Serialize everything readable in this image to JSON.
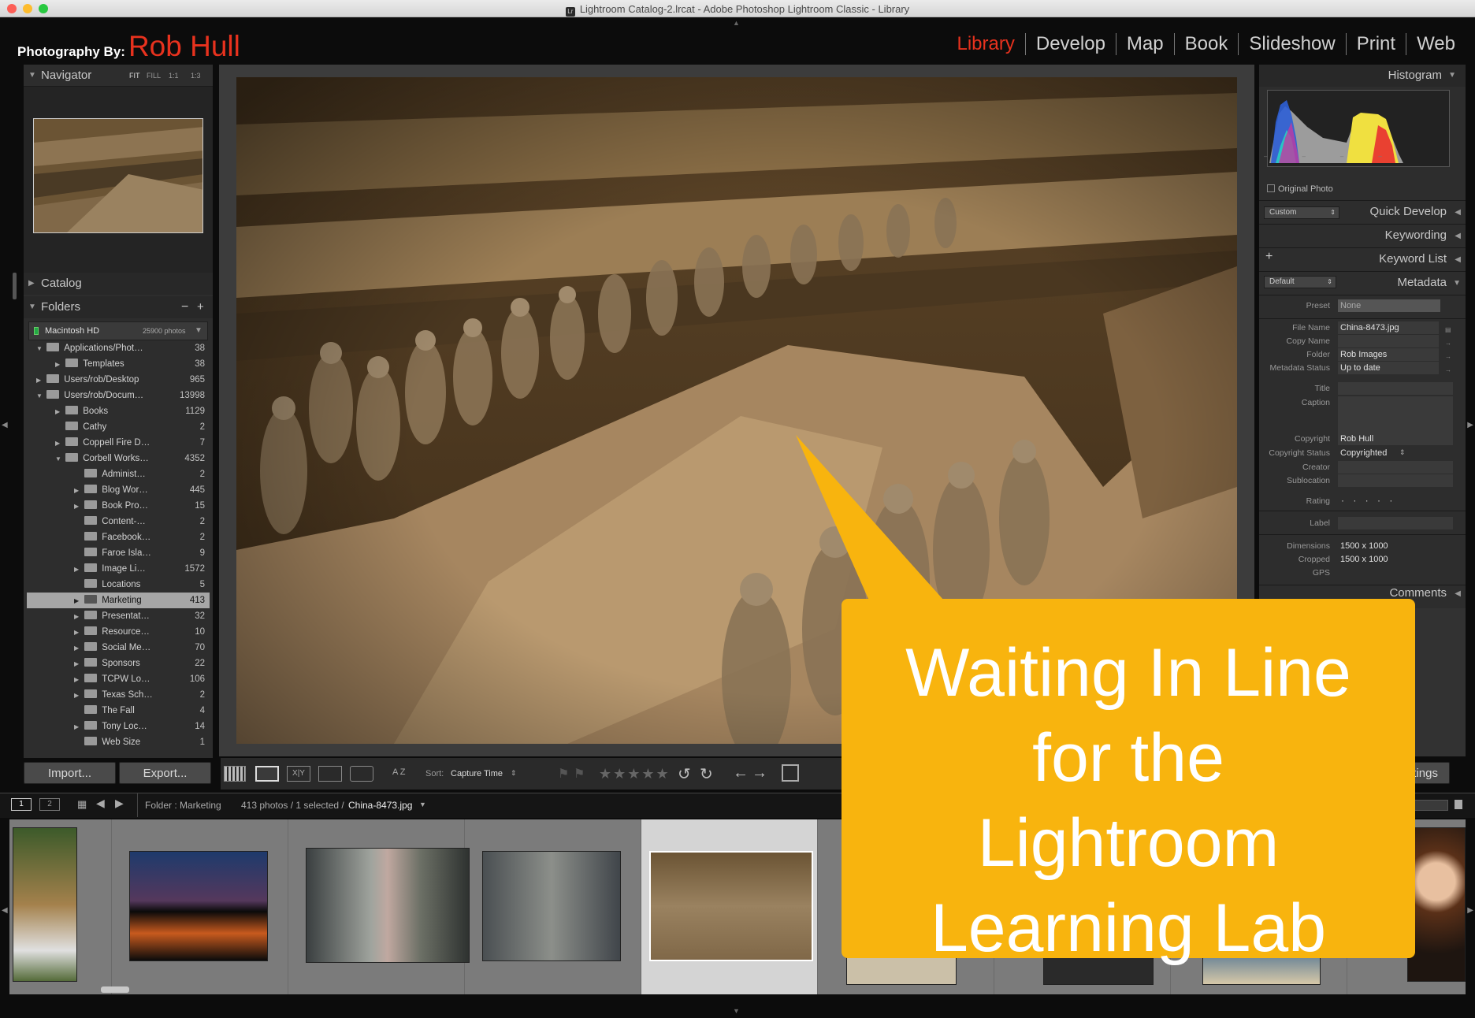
{
  "window": {
    "title": "Lightroom Catalog-2.lrcat - Adobe Photoshop Lightroom Classic - Library",
    "icon": "lr-icon"
  },
  "identity": {
    "prefix": "Photography By:",
    "name": "Rob Hull"
  },
  "modules": [
    "Library",
    "Develop",
    "Map",
    "Book",
    "Slideshow",
    "Print",
    "Web"
  ],
  "navigator": {
    "title": "Navigator",
    "zoom": [
      "FIT",
      "FILL",
      "1:1",
      "1:3"
    ]
  },
  "catalog": {
    "title": "Catalog"
  },
  "folders": {
    "title": "Folders",
    "volume": "Macintosh HD",
    "volume_count": "25900 photos",
    "rows": [
      {
        "label": "Applications/Phot…",
        "count": "38"
      },
      {
        "label": "Templates",
        "count": "38"
      },
      {
        "label": "Users/rob/Desktop",
        "count": "965"
      },
      {
        "label": "Users/rob/Docum…",
        "count": "13998"
      },
      {
        "label": "Books",
        "count": "1129"
      },
      {
        "label": "Cathy",
        "count": "2"
      },
      {
        "label": "Coppell Fire D…",
        "count": "7"
      },
      {
        "label": "Corbell Works…",
        "count": "4352"
      },
      {
        "label": "Administ…",
        "count": "2"
      },
      {
        "label": "Blog Wor…",
        "count": "445"
      },
      {
        "label": "Book Pro…",
        "count": "15"
      },
      {
        "label": "Content-…",
        "count": "2"
      },
      {
        "label": "Facebook…",
        "count": "2"
      },
      {
        "label": "Faroe Isla…",
        "count": "9"
      },
      {
        "label": "Image Li…",
        "count": "1572"
      },
      {
        "label": "Locations",
        "count": "5"
      },
      {
        "label": "Marketing",
        "count": "413"
      },
      {
        "label": "Presentat…",
        "count": "32"
      },
      {
        "label": "Resource…",
        "count": "10"
      },
      {
        "label": "Social Me…",
        "count": "70"
      },
      {
        "label": "Sponsors",
        "count": "22"
      },
      {
        "label": "TCPW Lo…",
        "count": "106"
      },
      {
        "label": "Texas Sch…",
        "count": "2"
      },
      {
        "label": "The Fall",
        "count": "4"
      },
      {
        "label": "Tony Loc…",
        "count": "14"
      },
      {
        "label": "Web Size",
        "count": "1"
      }
    ]
  },
  "buttons": {
    "import": "Import...",
    "export": "Export...",
    "sync": "ttings"
  },
  "right": {
    "histogram": "Histogram",
    "original_photo": "Original Photo",
    "quick_develop": "Quick Develop",
    "qd_preset": "Custom",
    "keywording": "Keywording",
    "keyword_list": "Keyword List",
    "metadata": "Metadata",
    "md_preset": "Default",
    "comments": "Comments",
    "fields": [
      {
        "label": "Preset",
        "value": "None"
      },
      {
        "label": "File Name",
        "value": "China-8473.jpg"
      },
      {
        "label": "Copy Name",
        "value": ""
      },
      {
        "label": "Folder",
        "value": "Rob Images"
      },
      {
        "label": "Metadata Status",
        "value": "Up to date"
      },
      {
        "label": "Title",
        "value": ""
      },
      {
        "label": "Caption",
        "value": ""
      },
      {
        "label": "Copyright",
        "value": "Rob Hull"
      },
      {
        "label": "Copyright Status",
        "value": "Copyrighted"
      },
      {
        "label": "Creator",
        "value": ""
      },
      {
        "label": "Sublocation",
        "value": ""
      },
      {
        "label": "Rating",
        "value": "· · · · ·"
      },
      {
        "label": "Label",
        "value": ""
      },
      {
        "label": "Dimensions",
        "value": "1500 x 1000"
      },
      {
        "label": "Cropped",
        "value": "1500 x 1000"
      },
      {
        "label": "GPS",
        "value": ""
      }
    ]
  },
  "toolbar": {
    "sort_label": "Sort:",
    "sort_value": "Capture Time",
    "az": "A Z"
  },
  "filmbar": {
    "page1": "1",
    "page2": "2",
    "source": "Folder : Marketing",
    "count": "413 photos / 1 selected /",
    "file": "China-8473.jpg"
  },
  "callout": {
    "lines": [
      "Waiting In Line",
      "for the",
      "Lightroom",
      "Learning Lab"
    ]
  },
  "colors": {
    "accent": "#e8321e",
    "callout": "#f8b40e"
  }
}
